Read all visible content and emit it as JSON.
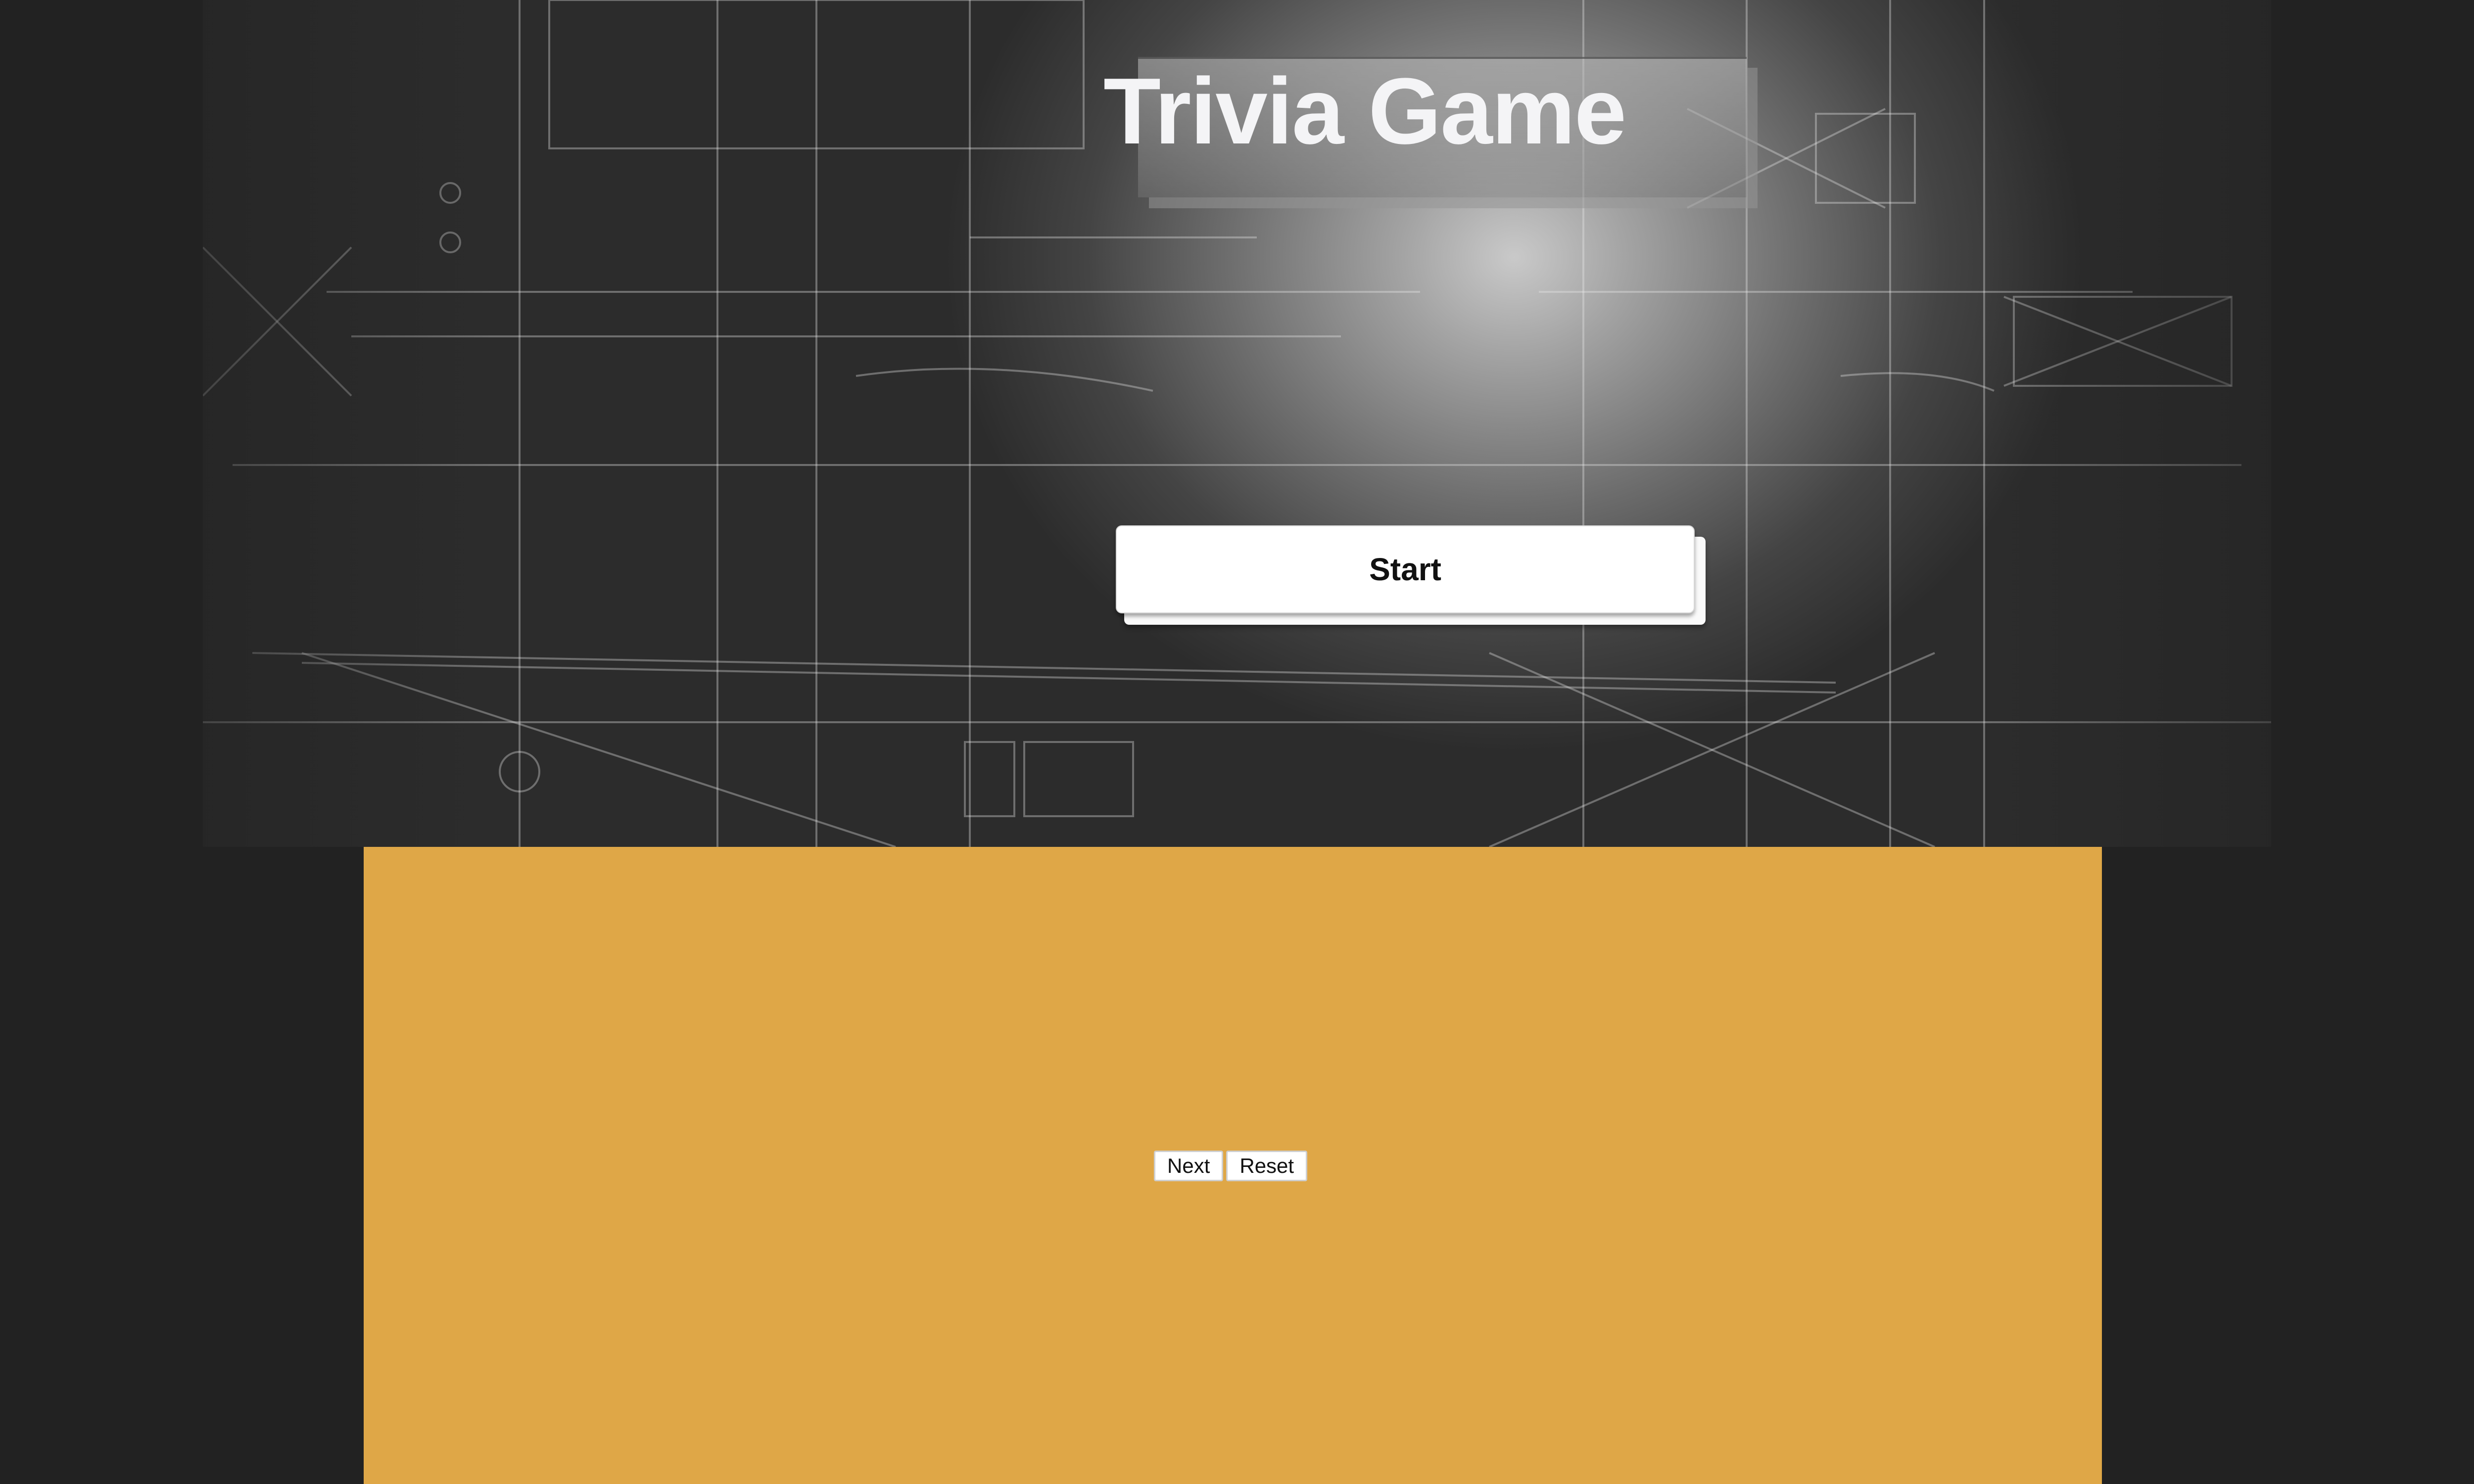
{
  "page": {
    "title": "Trivia Game"
  },
  "actions": {
    "start_label": "Start"
  },
  "panel": {
    "next_label": "Next",
    "reset_label": "Reset"
  },
  "colors": {
    "page_background": "#222222",
    "panel_background": "#dfa747",
    "title_text": "#f4f4f6",
    "button_background": "#ffffff"
  }
}
